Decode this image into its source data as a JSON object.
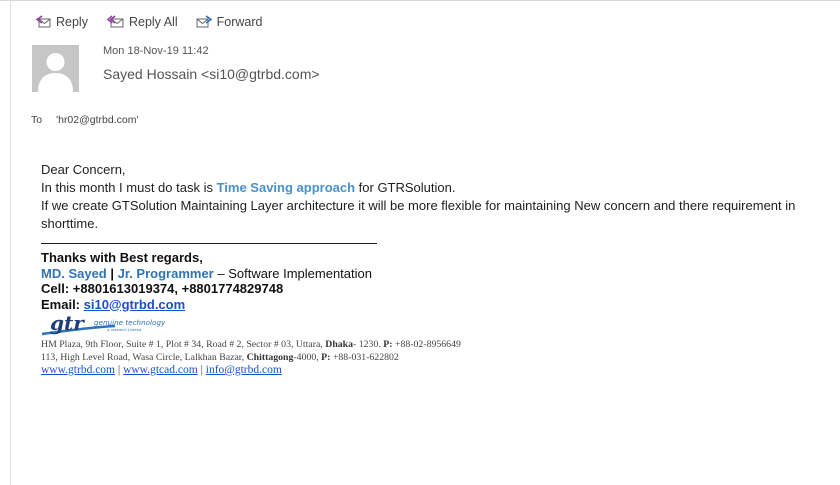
{
  "toolbar": {
    "reply": "Reply",
    "reply_all": "Reply All",
    "forward": "Forward"
  },
  "message": {
    "date": "Mon 18-Nov-19 11:42",
    "sender": "Sayed Hossain <si10@gtrbd.com>",
    "to_label": "To",
    "to_value": "'hr02@gtrbd.com'"
  },
  "body": {
    "greeting": "Dear Concern,",
    "line2_prefix": "In this month I must do task is ",
    "line2_highlight": "Time Saving approach",
    "line2_suffix": " for GTRSolution.",
    "line3": "If we create GTSolution Maintaining Layer architecture it will be more flexible for maintaining New concern and there requirement in shorttime."
  },
  "signature": {
    "regards": "Thanks with Best regards,",
    "name": "MD. Sayed",
    "separator": " | ",
    "title": "Jr. Programmer",
    "dept": " – Software Implementation",
    "cell_label": "Cell: ",
    "cell": "+8801613019374, +8801774829748",
    "email_label": "Email: ",
    "email": "si10@gtrbd.com",
    "logo_text": "gtr",
    "logo_tagline": "genuine technology",
    "logo_tagline_small": "& research Limited",
    "addr1_a": "HM Plaza, 9th Floor, Suite # 1, Plot # 34, Road # 2, Sector # 03, Uttara, ",
    "addr1_city": "Dhaka",
    "addr1_b": "- 1230. ",
    "addr1_phone_label": "P:",
    "addr1_phone": " +88-02-8956649",
    "addr2_a": "113, High Level Road, Wasa Circle, Lalkhan Bazar, ",
    "addr2_city": "Chittagong",
    "addr2_b": "-4000, ",
    "addr2_phone_label": "P:",
    "addr2_phone": " +88-031-622802",
    "link1": "www.gtrbd.com",
    "link2": "www.gtcad.com",
    "link3": "info@gtrbd.com",
    "link_sep": " | "
  },
  "colors": {
    "highlight": "#4a90c9",
    "signature_blue": "#2e74b5",
    "link": "#1a4fd0"
  }
}
